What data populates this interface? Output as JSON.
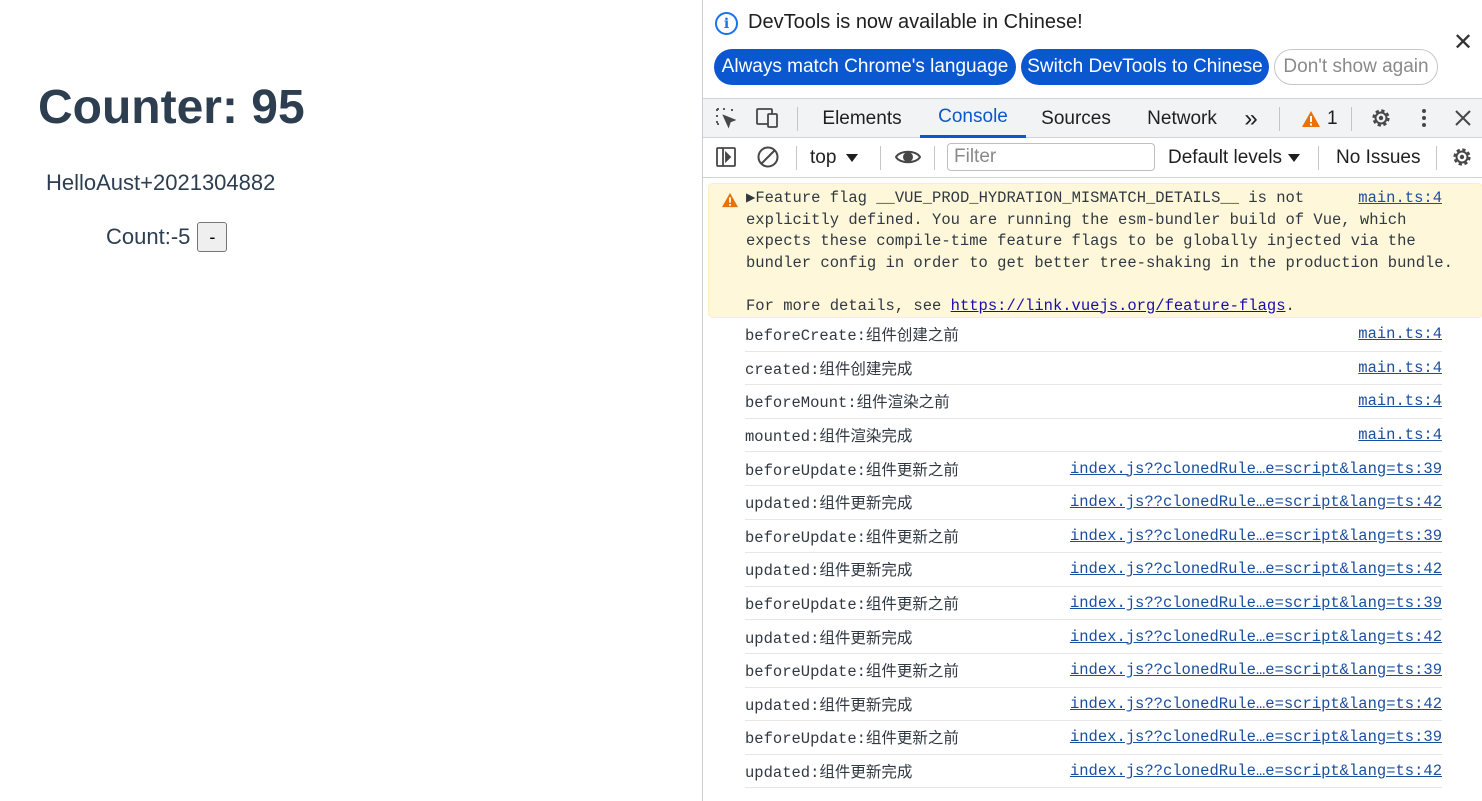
{
  "page": {
    "counter_title": "Counter: 95",
    "hello_text": "HelloAust+2021304882",
    "count_label": "Count:-5",
    "minus_label": "-"
  },
  "devtools": {
    "notice": {
      "text": "DevTools is now available in Chinese!",
      "info_icon": "i",
      "close_icon": "✕",
      "btn_match": "Always match Chrome's language",
      "btn_switch": "Switch DevTools to Chinese",
      "btn_dont": "Don't show again"
    },
    "tabs": [
      "Elements",
      "Console",
      "Sources",
      "Network"
    ],
    "more_tabs": "»",
    "warning_count": "1",
    "toolbar": {
      "context": "top",
      "filter_placeholder": "Filter",
      "levels": "Default levels",
      "issues": "No Issues"
    },
    "console": {
      "warning": {
        "text": "▶Feature flag __VUE_PROD_HYDRATION_MISMATCH_DETAILS__ is not\nexplicitly defined. You are running the esm-bundler build of Vue, which\nexpects these compile-time feature flags to be globally injected via the\nbundler config in order to get better tree-shaking in the production bundle.\n\nFor more details, see ",
        "link": "https://link.vuejs.org/feature-flags",
        "after_link": ".",
        "source": "main.ts:4"
      },
      "logs": [
        {
          "message": "beforeCreate:组件创建之前",
          "source": "main.ts:4"
        },
        {
          "message": "created:组件创建完成",
          "source": "main.ts:4"
        },
        {
          "message": "beforeMount:组件渲染之前",
          "source": "main.ts:4"
        },
        {
          "message": "mounted:组件渲染完成",
          "source": "main.ts:4"
        },
        {
          "message": "beforeUpdate:组件更新之前",
          "source": "index.js??clonedRule…e=script&lang=ts:39"
        },
        {
          "message": "updated:组件更新完成",
          "source": "index.js??clonedRule…e=script&lang=ts:42"
        },
        {
          "message": "beforeUpdate:组件更新之前",
          "source": "index.js??clonedRule…e=script&lang=ts:39"
        },
        {
          "message": "updated:组件更新完成",
          "source": "index.js??clonedRule…e=script&lang=ts:42"
        },
        {
          "message": "beforeUpdate:组件更新之前",
          "source": "index.js??clonedRule…e=script&lang=ts:39"
        },
        {
          "message": "updated:组件更新完成",
          "source": "index.js??clonedRule…e=script&lang=ts:42"
        },
        {
          "message": "beforeUpdate:组件更新之前",
          "source": "index.js??clonedRule…e=script&lang=ts:39"
        },
        {
          "message": "updated:组件更新完成",
          "source": "index.js??clonedRule…e=script&lang=ts:42"
        },
        {
          "message": "beforeUpdate:组件更新之前",
          "source": "index.js??clonedRule…e=script&lang=ts:39"
        },
        {
          "message": "updated:组件更新完成",
          "source": "index.js??clonedRule…e=script&lang=ts:42"
        }
      ]
    },
    "colors": {
      "accent": "#0b57d0",
      "warning_bg": "#fef7d9",
      "warning_icon": "#e8710a"
    }
  }
}
